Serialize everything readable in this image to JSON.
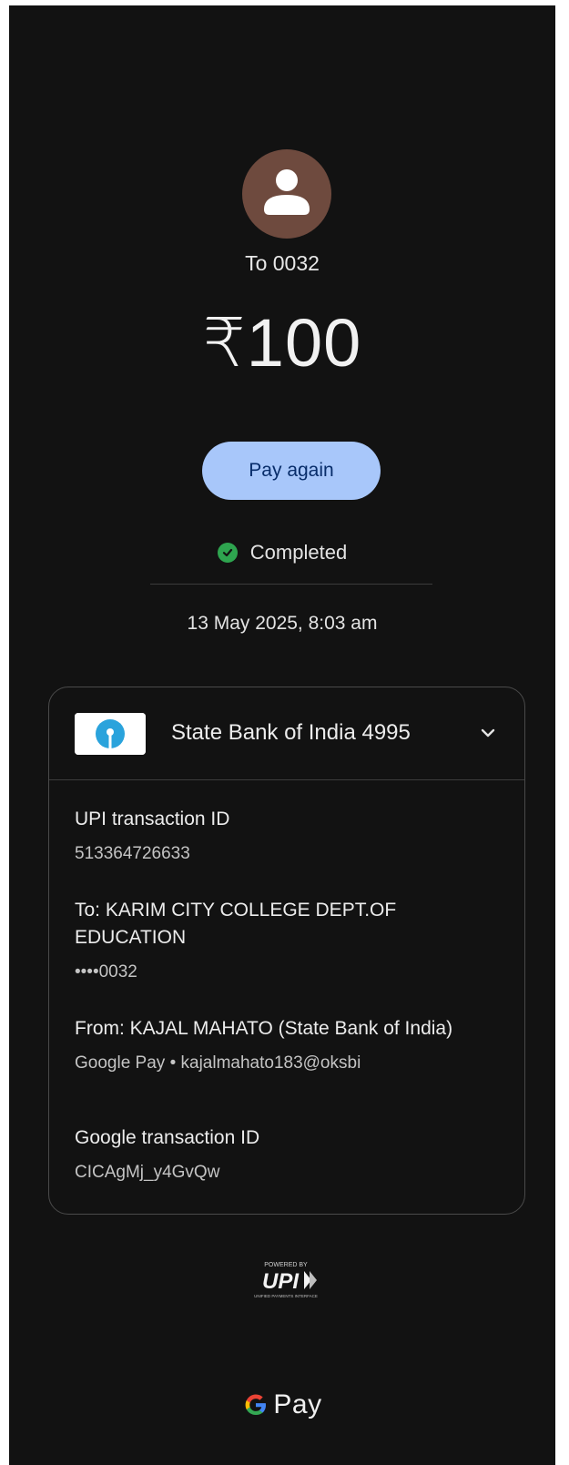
{
  "header": {
    "recipient_label": "To 0032",
    "amount": "₹100",
    "pay_again_label": "Pay again",
    "status": "Completed",
    "datetime": "13 May 2025, 8:03 am"
  },
  "bank": {
    "name": "State Bank of India 4995",
    "logo": "sbi-logo",
    "chevron": "chevron-down-icon"
  },
  "details": [
    {
      "label": "UPI transaction ID",
      "value": "513364726633"
    },
    {
      "label": "To: KARIM CITY COLLEGE DEPT.OF EDUCATION",
      "value": "••••0032"
    },
    {
      "label": "From: KAJAL  MAHATO (State Bank of India)",
      "value": "Google Pay • kajalmahato183@oksbi"
    },
    {
      "label": "Google transaction ID",
      "value": "CICAgMj_y4GvQw"
    }
  ],
  "footer": {
    "upi_powered_by": "POWERED BY",
    "upi_logo_text": "UPI",
    "upi_tagline": "UNIFIED PAYMENTS INTERFACE",
    "gpay_text": "Pay"
  },
  "colors": {
    "background": "#121212",
    "accent_button": "#a8c7fa",
    "success": "#2ea44f",
    "avatar": "#6e4a3e"
  }
}
